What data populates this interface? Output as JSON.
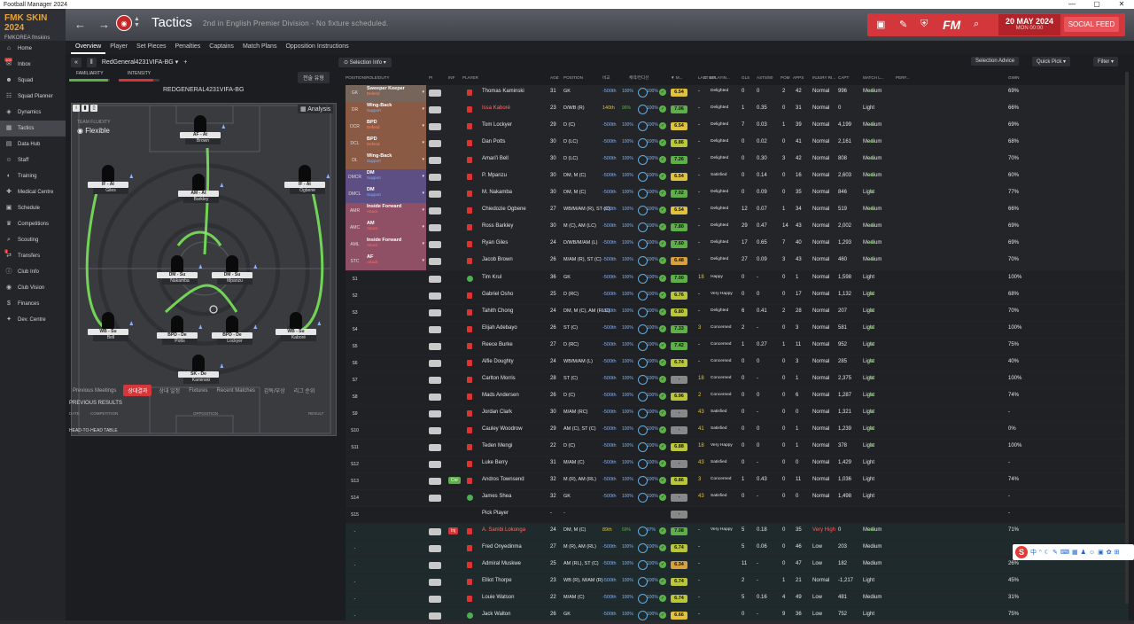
{
  "window_title": "Football Manager 2024",
  "window_controls": [
    "—",
    "▢",
    "✕"
  ],
  "brand": {
    "title": "FMK SKIN 2024",
    "subtitle": "FMKOREA fmskins"
  },
  "header": {
    "title": "Tactics",
    "subtitle": "2nd in English Premier Division - No fixture scheduled.",
    "date": "20 MAY 2024",
    "time": "MON 00:00",
    "social_feed": "SOCIAL FEED",
    "fm_logo": "FM",
    "back_icon": "←",
    "forward_icon": "→"
  },
  "sidebar": [
    {
      "label": "Home",
      "icon": "home-icon",
      "glyph": "⌂"
    },
    {
      "label": "Inbox",
      "icon": "inbox-icon",
      "glyph": "✉",
      "badge": "105"
    },
    {
      "label": "Squad",
      "icon": "squad-icon",
      "glyph": "☻"
    },
    {
      "label": "Squad Planner",
      "icon": "planner-icon",
      "glyph": "☷"
    },
    {
      "label": "Dynamics",
      "icon": "dynamics-icon",
      "glyph": "◈"
    },
    {
      "label": "Tactics",
      "icon": "tactics-icon",
      "glyph": "▦",
      "active": true
    },
    {
      "label": "Data Hub",
      "icon": "datahub-icon",
      "glyph": "▤"
    },
    {
      "label": "Staff",
      "icon": "staff-icon",
      "glyph": "☺"
    },
    {
      "label": "Training",
      "icon": "training-icon",
      "glyph": "◐"
    },
    {
      "label": "Medical Centre",
      "icon": "medical-icon",
      "glyph": "✚"
    },
    {
      "label": "Schedule",
      "icon": "schedule-icon",
      "glyph": "▣"
    },
    {
      "label": "Competitions",
      "icon": "competitions-icon",
      "glyph": "♛"
    },
    {
      "label": "Scouting",
      "icon": "scouting-icon",
      "glyph": "⌕"
    },
    {
      "label": "Transfers",
      "icon": "transfers-icon",
      "glyph": "⇄",
      "badge": "1"
    },
    {
      "label": "Club Info",
      "icon": "clubinfo-icon",
      "glyph": "ⓘ"
    },
    {
      "label": "Club Vision",
      "icon": "clubvision-icon",
      "glyph": "◉"
    },
    {
      "label": "Finances",
      "icon": "finances-icon",
      "glyph": "$"
    },
    {
      "label": "Dev. Centre",
      "icon": "devcentre-icon",
      "glyph": "✦"
    }
  ],
  "tabs": [
    "Overview",
    "Player",
    "Set Pieces",
    "Penalties",
    "Captains",
    "Match Plans",
    "Opposition Instructions"
  ],
  "left": {
    "collapse": "«",
    "pause": "‖",
    "tactic_name": "RedGeneral4231VIFA-BG",
    "add": "+",
    "familiarity": "FAMILIARITY",
    "intensity": "INTENSITY",
    "familiarity_value": 0.95,
    "intensity_value": 0.85,
    "korean_btn": "전술 유형",
    "tactic_title": "REDGENERAL4231VIFA-BG",
    "fluidity_label": "TEAM FLUIDITY",
    "fluidity": "Flexible",
    "analysis": "Analysis",
    "badges": [
      "i",
      "▮",
      "▯"
    ],
    "bottom_tabs": [
      "Previous Meetings",
      "상대결과",
      "상대 일정",
      "Fixtures",
      "Recent Matches",
      "감독/부상",
      "리그 순위"
    ],
    "prev_results": "PREVIOUS RESULTS",
    "prev_headers": [
      "DATE",
      "COMPETITION",
      "OPPOSITION",
      "RESULT"
    ],
    "h2h": "HEAD-TO-HEAD TABLE"
  },
  "pitch": [
    {
      "role": "AF - At",
      "name": "Brown"
    },
    {
      "role": "IF - At",
      "name": "Giles"
    },
    {
      "role": "AM - At",
      "name": "Barkley"
    },
    {
      "role": "IF - At",
      "name": "Ogbene"
    },
    {
      "role": "DM - Su",
      "name": "Nakamba"
    },
    {
      "role": "DM - Su",
      "name": "Mpanzu"
    },
    {
      "role": "WB - Su",
      "name": "Bell"
    },
    {
      "role": "BPD - De",
      "name": "Potts"
    },
    {
      "role": "BPD - De",
      "name": "Lockyer"
    },
    {
      "role": "WB - Su",
      "name": "Kaboré"
    },
    {
      "role": "SK - De",
      "name": "Kaminski"
    }
  ],
  "main": {
    "selection_info": "Selection Info",
    "selection_advice": "Selection Advice",
    "quick_pick": "Quick Pick",
    "filter": "Filter"
  },
  "columns": [
    "POSITION/ROLE/DUTY",
    "PI",
    "INF",
    "PLAYER",
    "AGE",
    "POSITION",
    "비교",
    "체력/컨디션",
    "▼ M...",
    "LAST 5...",
    "G. MIS",
    "PLAYIN...",
    "GLS",
    "ASTS/90",
    "POM",
    "APPS",
    "INJURY RI...",
    "CAPT",
    "MATCH L...",
    "PERF...",
    "GWIN"
  ],
  "colors": {
    "accent": "#d4373b",
    "att": "#8f4f65",
    "mid": "#5d4e83",
    "def": "#8a5a45",
    "gk": "#76655b",
    "green": "#5db048",
    "yellow": "#e1c23c",
    "orange": "#d8a03c"
  },
  "rows": [
    {
      "slot": "GK",
      "role": "Sweeper Keeper",
      "duty": "Defend",
      "pi": "",
      "inf": "",
      "name": "Thomas Kaminski",
      "age": "31",
      "pos": "GK",
      "cmp": "-500th",
      "pct": "100%",
      "cond": "100%",
      "rat": "6.54",
      "gmis": "-",
      "play": "Delighted",
      "gls": "0",
      "asts": "0",
      "pom": "2",
      "apps": "42",
      "inj": "Normal",
      "capt": "996",
      "ml": "Medium",
      "arr": "▲",
      "gwin": "69%",
      "group": "gk"
    },
    {
      "slot": "DR",
      "role": "Wing-Back",
      "duty": "Support",
      "pi": "",
      "inf": "",
      "name": "Issa Kaboré",
      "age": "23",
      "pos": "D/WB (R)",
      "cmp": "140th",
      "pct": "96%",
      "cond": "100%",
      "rat": "7.06",
      "gmis": "-",
      "play": "Delighted",
      "gls": "1",
      "asts": "0.35",
      "pom": "0",
      "apps": "31",
      "inj": "Normal",
      "capt": "0",
      "ml": "Light",
      "arr": "",
      "gwin": "66%",
      "group": "def",
      "hl": true
    },
    {
      "slot": "DCR",
      "role": "BPD",
      "duty": "Defend",
      "pi": "",
      "inf": "",
      "name": "Tom Lockyer",
      "age": "29",
      "pos": "D (C)",
      "cmp": "-500th",
      "pct": "100%",
      "cond": "100%",
      "rat": "6.54",
      "gmis": "-",
      "play": "Delighted",
      "gls": "7",
      "asts": "0.03",
      "pom": "1",
      "apps": "39",
      "inj": "Normal",
      "capt": "4,199",
      "ml": "Medium",
      "arr": "▲",
      "gwin": "69%",
      "group": "def"
    },
    {
      "slot": "DCL",
      "role": "BPD",
      "duty": "Defend",
      "pi": "",
      "inf": "",
      "name": "Dan Potts",
      "age": "30",
      "pos": "D (LC)",
      "cmp": "-500th",
      "pct": "100%",
      "cond": "100%",
      "rat": "6.86",
      "gmis": "-",
      "play": "Delighted",
      "gls": "0",
      "asts": "0.02",
      "pom": "0",
      "apps": "41",
      "inj": "Normal",
      "capt": "2,161",
      "ml": "Medium",
      "arr": "▲",
      "gwin": "68%",
      "group": "def"
    },
    {
      "slot": "DL",
      "role": "Wing-Back",
      "duty": "Support",
      "pi": "",
      "inf": "",
      "name": "Amari'i Bell",
      "age": "30",
      "pos": "D (LC)",
      "cmp": "-500th",
      "pct": "100%",
      "cond": "100%",
      "rat": "7.26",
      "gmis": "-",
      "play": "Delighted",
      "gls": "0",
      "asts": "0.30",
      "pom": "3",
      "apps": "42",
      "inj": "Normal",
      "capt": "808",
      "ml": "Medium",
      "arr": "▲",
      "gwin": "70%",
      "group": "def"
    },
    {
      "slot": "DMCR",
      "role": "DM",
      "duty": "Support",
      "pi": "",
      "inf": "",
      "name": "P. Mpanzu",
      "age": "30",
      "pos": "DM, M (C)",
      "cmp": "-500th",
      "pct": "100%",
      "cond": "100%",
      "rat": "6.54",
      "gmis": "-",
      "play": "Satisfied",
      "gls": "0",
      "asts": "0.14",
      "pom": "0",
      "apps": "16",
      "inj": "Normal",
      "capt": "2,603",
      "ml": "Medium",
      "arr": "▲",
      "gwin": "60%",
      "group": "mid"
    },
    {
      "slot": "DMCL",
      "role": "DM",
      "duty": "Support",
      "pi": "",
      "inf": "",
      "name": "M. Nakamba",
      "age": "30",
      "pos": "DM, M (C)",
      "cmp": "-500th",
      "pct": "100%",
      "cond": "100%",
      "rat": "7.02",
      "gmis": "-",
      "play": "Delighted",
      "gls": "0",
      "asts": "0.09",
      "pom": "0",
      "apps": "35",
      "inj": "Normal",
      "capt": "846",
      "ml": "Light",
      "arr": "▲",
      "gwin": "77%",
      "group": "mid"
    },
    {
      "slot": "AMR",
      "role": "Inside Forward",
      "duty": "Attack",
      "pi": "",
      "inf": "",
      "name": "Chiedozie Ogbene",
      "age": "27",
      "pos": "WB/M/AM (R), ST (C)",
      "cmp": "-500th",
      "pct": "100%",
      "cond": "100%",
      "rat": "6.54",
      "gmis": "-",
      "play": "Delighted",
      "gls": "12",
      "asts": "0.07",
      "pom": "1",
      "apps": "34",
      "inj": "Normal",
      "capt": "519",
      "ml": "Medium",
      "arr": "▲",
      "gwin": "66%",
      "group": "att"
    },
    {
      "slot": "AMC",
      "role": "AM",
      "duty": "Attack",
      "pi": "",
      "inf": "",
      "name": "Ross Barkley",
      "age": "30",
      "pos": "M (C), AM (LC)",
      "cmp": "-500th",
      "pct": "100%",
      "cond": "100%",
      "rat": "7.80",
      "gmis": "-",
      "play": "Delighted",
      "gls": "29",
      "asts": "0.47",
      "pom": "14",
      "apps": "43",
      "inj": "Normal",
      "capt": "2,002",
      "ml": "Medium",
      "arr": "▲",
      "gwin": "69%",
      "group": "att"
    },
    {
      "slot": "AML",
      "role": "Inside Forward",
      "duty": "Attack",
      "pi": "",
      "inf": "",
      "name": "Ryan Giles",
      "age": "24",
      "pos": "D/WB/M/AM (L)",
      "cmp": "-500th",
      "pct": "100%",
      "cond": "100%",
      "rat": "7.60",
      "gmis": "-",
      "play": "Delighted",
      "gls": "17",
      "asts": "0.65",
      "pom": "7",
      "apps": "40",
      "inj": "Normal",
      "capt": "1,293",
      "ml": "Medium",
      "arr": "▲",
      "gwin": "69%",
      "group": "att"
    },
    {
      "slot": "STC",
      "role": "AF",
      "duty": "Attack",
      "pi": "",
      "inf": "",
      "name": "Jacob Brown",
      "age": "26",
      "pos": "M/AM (R), ST (C)",
      "cmp": "-500th",
      "pct": "100%",
      "cond": "100%",
      "rat": "6.48",
      "gmis": "-",
      "play": "Delighted",
      "gls": "27",
      "asts": "0.09",
      "pom": "3",
      "apps": "43",
      "inj": "Normal",
      "capt": "460",
      "ml": "Medium",
      "arr": "▲",
      "gwin": "70%",
      "group": "att"
    },
    {
      "slot": "S1",
      "name": "Tim Krul",
      "age": "36",
      "pos": "GK",
      "cmp": "-500th",
      "pct": "100%",
      "cond": "100%",
      "rat": "7.00",
      "gmis": "18",
      "play": "Happy",
      "gls": "0",
      "asts": "-",
      "pom": "0",
      "apps": "1",
      "inj": "Normal",
      "capt": "1,598",
      "ml": "Light",
      "arr": "",
      "gwin": "100%",
      "group": "sub",
      "green": true
    },
    {
      "slot": "S2",
      "name": "Gabriel Osho",
      "age": "25",
      "pos": "D (RC)",
      "cmp": "-500th",
      "pct": "100%",
      "cond": "100%",
      "rat": "6.76",
      "gmis": "-",
      "play": "Very Happy",
      "gls": "0",
      "asts": "0",
      "pom": "0",
      "apps": "17",
      "inj": "Normal",
      "capt": "1,132",
      "ml": "Light",
      "arr": "▲",
      "gwin": "68%",
      "group": "sub"
    },
    {
      "slot": "S3",
      "name": "Tahith Chong",
      "age": "24",
      "pos": "DM, M (C), AM (RLC)",
      "cmp": "-500th",
      "pct": "100%",
      "cond": "100%",
      "rat": "6.80",
      "gmis": "-",
      "play": "Delighted",
      "gls": "6",
      "asts": "0.41",
      "pom": "2",
      "apps": "28",
      "inj": "Normal",
      "capt": "207",
      "ml": "Light",
      "arr": "▲",
      "gwin": "70%",
      "group": "sub"
    },
    {
      "slot": "S4",
      "name": "Elijah Adebayo",
      "age": "26",
      "pos": "ST (C)",
      "cmp": "-500th",
      "pct": "100%",
      "cond": "100%",
      "rat": "7.33",
      "gmis": "3",
      "play": "Concerned",
      "gls": "2",
      "asts": "-",
      "pom": "0",
      "apps": "3",
      "inj": "Normal",
      "capt": "581",
      "ml": "Light",
      "arr": "▲",
      "gwin": "100%",
      "group": "sub"
    },
    {
      "slot": "S5",
      "name": "Reece Burke",
      "age": "27",
      "pos": "D (RC)",
      "cmp": "-500th",
      "pct": "100%",
      "cond": "100%",
      "rat": "7.42",
      "gmis": "-",
      "play": "Concerned",
      "gls": "1",
      "asts": "0.27",
      "pom": "1",
      "apps": "11",
      "inj": "Normal",
      "capt": "952",
      "ml": "Light",
      "arr": "▲",
      "gwin": "75%",
      "group": "sub"
    },
    {
      "slot": "S6",
      "name": "Alfie Doughty",
      "age": "24",
      "pos": "WB/M/AM (L)",
      "cmp": "-500th",
      "pct": "100%",
      "cond": "100%",
      "rat": "6.74",
      "gmis": "-",
      "play": "Concerned",
      "gls": "0",
      "asts": "0",
      "pom": "0",
      "apps": "3",
      "inj": "Normal",
      "capt": "285",
      "ml": "Light",
      "arr": "▲",
      "gwin": "40%",
      "group": "sub"
    },
    {
      "slot": "S7",
      "name": "Carlton Morris",
      "age": "28",
      "pos": "ST (C)",
      "cmp": "-500th",
      "pct": "100%",
      "cond": "100%",
      "rat": "-",
      "gmis": "18",
      "play": "Concerned",
      "gls": "0",
      "asts": "-",
      "pom": "0",
      "apps": "1",
      "inj": "Normal",
      "capt": "2,375",
      "ml": "Light",
      "arr": "▲",
      "gwin": "100%",
      "group": "sub"
    },
    {
      "slot": "S8",
      "name": "Mads Andersen",
      "age": "26",
      "pos": "D (C)",
      "cmp": "-500th",
      "pct": "100%",
      "cond": "100%",
      "rat": "6.96",
      "gmis": "2",
      "play": "Concerned",
      "gls": "0",
      "asts": "0",
      "pom": "0",
      "apps": "6",
      "inj": "Normal",
      "capt": "1,287",
      "ml": "Light",
      "arr": "▲",
      "gwin": "74%",
      "group": "sub"
    },
    {
      "slot": "S9",
      "name": "Jordan Clark",
      "age": "30",
      "pos": "M/AM (RC)",
      "cmp": "-500th",
      "pct": "100%",
      "cond": "100%",
      "rat": "-",
      "gmis": "43",
      "play": "Satisfied",
      "gls": "0",
      "asts": "-",
      "pom": "0",
      "apps": "0",
      "inj": "Normal",
      "capt": "1,321",
      "ml": "Light",
      "arr": "▲",
      "gwin": "-",
      "group": "sub"
    },
    {
      "slot": "S10",
      "name": "Cauley Woodrow",
      "age": "29",
      "pos": "AM (C), ST (C)",
      "cmp": "-500th",
      "pct": "100%",
      "cond": "100%",
      "rat": "-",
      "gmis": "41",
      "play": "Satisfied",
      "gls": "0",
      "asts": "0",
      "pom": "0",
      "apps": "1",
      "inj": "Normal",
      "capt": "1,239",
      "ml": "Light",
      "arr": "▲",
      "gwin": "0%",
      "group": "sub"
    },
    {
      "slot": "S11",
      "name": "Teden Mengi",
      "age": "22",
      "pos": "D (C)",
      "cmp": "-500th",
      "pct": "100%",
      "cond": "100%",
      "rat": "6.88",
      "gmis": "18",
      "play": "Very Happy",
      "gls": "0",
      "asts": "0",
      "pom": "0",
      "apps": "1",
      "inj": "Normal",
      "capt": "378",
      "ml": "Light",
      "arr": "▲",
      "gwin": "100%",
      "group": "sub"
    },
    {
      "slot": "S12",
      "name": "Luke Berry",
      "age": "31",
      "pos": "M/AM (C)",
      "cmp": "-500th",
      "pct": "100%",
      "cond": "100%",
      "rat": "-",
      "gmis": "43",
      "play": "Satisfied",
      "gls": "0",
      "asts": "-",
      "pom": "0",
      "apps": "0",
      "inj": "Normal",
      "capt": "1,429",
      "ml": "Light",
      "arr": "",
      "gwin": "-",
      "group": "sub"
    },
    {
      "slot": "S13",
      "name": "Andros Townsend",
      "age": "32",
      "pos": "M (R), AM (RL)",
      "cmp": "-500th",
      "pct": "100%",
      "cond": "100%",
      "rat": "6.86",
      "gmis": "3",
      "play": "Concerned",
      "gls": "1",
      "asts": "0.43",
      "pom": "0",
      "apps": "11",
      "inj": "Normal",
      "capt": "1,036",
      "ml": "Light",
      "arr": "",
      "gwin": "74%",
      "group": "sub",
      "tag": "Cnr"
    },
    {
      "slot": "S14",
      "name": "James Shea",
      "age": "32",
      "pos": "GK",
      "cmp": "-500th",
      "pct": "100%",
      "cond": "100%",
      "rat": "-",
      "gmis": "43",
      "play": "Satisfied",
      "gls": "0",
      "asts": "-",
      "pom": "0",
      "apps": "0",
      "inj": "Normal",
      "capt": "1,498",
      "ml": "Light",
      "arr": "",
      "gwin": "-",
      "group": "sub",
      "green": true
    },
    {
      "slot": "S15",
      "name": "Pick Player",
      "age": "-",
      "pos": "-",
      "cmp": "",
      "pct": "",
      "cond": "",
      "rat": "-",
      "gmis": "",
      "play": "",
      "gls": "",
      "asts": "",
      "pom": "",
      "apps": "",
      "inj": "",
      "capt": "",
      "ml": "",
      "arr": "",
      "gwin": "-",
      "group": "empty"
    },
    {
      "slot": "-",
      "name": "A. Sambi Lokonga",
      "age": "24",
      "pos": "DM, M (C)",
      "cmp": "89th",
      "pct": "69%",
      "cond": "97%",
      "rat": "7.08",
      "gmis": "-",
      "play": "Very Happy",
      "gls": "5",
      "asts": "0.18",
      "pom": "0",
      "apps": "35",
      "inj": "Very High",
      "capt": "0",
      "ml": "Medium",
      "arr": "▲",
      "gwin": "71%",
      "group": "res",
      "tag": "Inj",
      "hl": true
    },
    {
      "slot": "-",
      "name": "Fred Onyedinma",
      "age": "27",
      "pos": "M (R), AM (RL)",
      "cmp": "-500th",
      "pct": "100%",
      "cond": "100%",
      "rat": "6.74",
      "gmis": "-",
      "play": "",
      "gls": "5",
      "asts": "0.06",
      "pom": "0",
      "apps": "46",
      "inj": "Low",
      "capt": "203",
      "ml": "Medium",
      "arr": "",
      "gwin": "",
      "group": "res"
    },
    {
      "slot": "-",
      "name": "Admiral Muskwe",
      "age": "25",
      "pos": "AM (RL), ST (C)",
      "cmp": "-500th",
      "pct": "100%",
      "cond": "100%",
      "rat": "6.34",
      "gmis": "-",
      "play": "",
      "gls": "11",
      "asts": "-",
      "pom": "0",
      "apps": "47",
      "inj": "Low",
      "capt": "182",
      "ml": "Medium",
      "arr": "",
      "gwin": "26%",
      "group": "res"
    },
    {
      "slot": "-",
      "name": "Elliot Thorpe",
      "age": "23",
      "pos": "WB (R), M/AM (R)",
      "cmp": "-500th",
      "pct": "100%",
      "cond": "100%",
      "rat": "6.74",
      "gmis": "-",
      "play": "",
      "gls": "2",
      "asts": "-",
      "pom": "1",
      "apps": "21",
      "inj": "Normal",
      "capt": "-1,217",
      "ml": "Light",
      "arr": "",
      "gwin": "45%",
      "group": "res"
    },
    {
      "slot": "-",
      "name": "Louie Watson",
      "age": "22",
      "pos": "M/AM (C)",
      "cmp": "-500th",
      "pct": "100%",
      "cond": "100%",
      "rat": "6.74",
      "gmis": "-",
      "play": "",
      "gls": "5",
      "asts": "0.16",
      "pom": "4",
      "apps": "49",
      "inj": "Low",
      "capt": "481",
      "ml": "Medium",
      "arr": "",
      "gwin": "31%",
      "group": "res"
    },
    {
      "slot": "-",
      "name": "Jack Walton",
      "age": "26",
      "pos": "GK",
      "cmp": "-500th",
      "pct": "100%",
      "cond": "100%",
      "rat": "6.66",
      "gmis": "-",
      "play": "",
      "gls": "0",
      "asts": "-",
      "pom": "9",
      "apps": "36",
      "inj": "Low",
      "capt": "752",
      "ml": "Light",
      "arr": "",
      "gwin": "75%",
      "group": "res",
      "green": true
    }
  ],
  "tray": {
    "s": "S",
    "icons": [
      "中",
      "ᐢ",
      "☾",
      "✎",
      "⌨",
      "▦",
      "♟",
      "☺",
      "▣",
      "✿",
      "⊞"
    ]
  }
}
